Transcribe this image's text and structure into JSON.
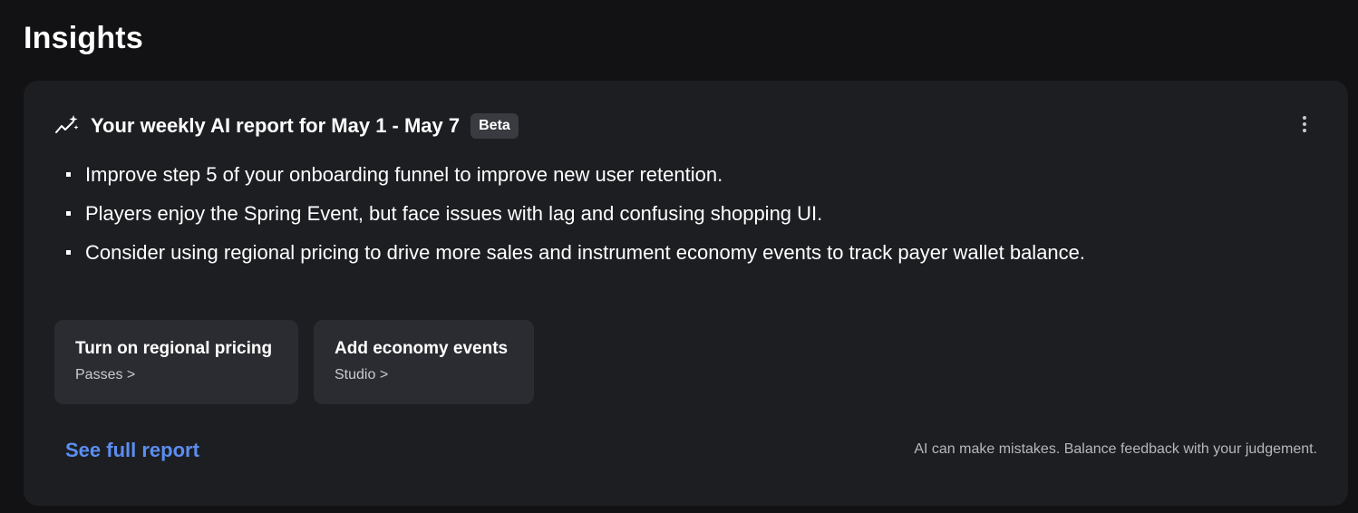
{
  "page": {
    "title": "Insights"
  },
  "report": {
    "title": "Your weekly AI report for May 1 - May 7",
    "badge": "Beta",
    "icon": "sparkle-trend-icon",
    "menu_icon": "more-vertical-icon",
    "bullets": [
      "Improve step 5 of your onboarding funnel to improve new user retention.",
      "Players enjoy the Spring Event, but face issues with lag and confusing shopping UI.",
      "Consider using regional pricing to drive more sales and instrument economy events to track payer wallet balance."
    ],
    "actions": [
      {
        "title": "Turn on regional pricing",
        "subtitle": "Passes >"
      },
      {
        "title": "Add economy events",
        "subtitle": "Studio >"
      }
    ],
    "link_label": "See full report",
    "disclaimer": "AI can make mistakes. Balance feedback with your judgement."
  },
  "colors": {
    "background": "#121215",
    "card": "#1d1e22",
    "action_card": "#2b2c31",
    "link": "#5b8ef0"
  }
}
